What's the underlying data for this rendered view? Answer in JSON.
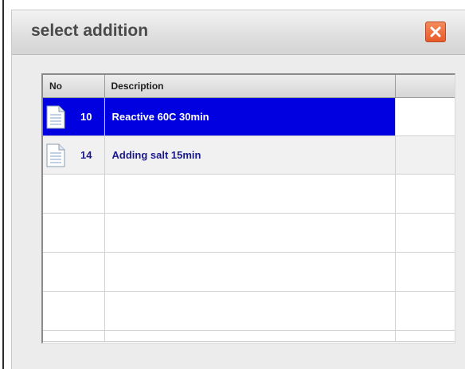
{
  "dialog": {
    "title": "select addition",
    "close_icon": "close-icon"
  },
  "table": {
    "columns": [
      "No",
      "Description",
      ""
    ],
    "rows": [
      {
        "no": "10",
        "description": "Reactive 60C 30min",
        "icon": "document-icon",
        "selected": true
      },
      {
        "no": "14",
        "description": "Adding salt 15min",
        "icon": "document-icon",
        "selected": false
      }
    ]
  },
  "colors": {
    "selection": "#0000e0",
    "row_text": "#1a1a8a",
    "close_button": "#e85a2a"
  }
}
